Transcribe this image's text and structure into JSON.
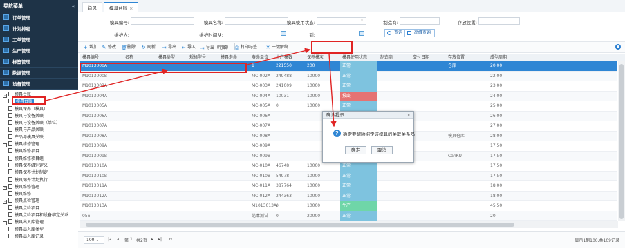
{
  "sidebar": {
    "title": "导航菜单",
    "collapse_icon": "«",
    "menus": [
      {
        "label": "订单管理"
      },
      {
        "label": "计划排程"
      },
      {
        "label": "工单管理"
      },
      {
        "label": "生产管理"
      },
      {
        "label": "标签管理"
      },
      {
        "label": "数据管理"
      },
      {
        "label": "设备管理"
      },
      {
        "label": "模具管理"
      }
    ],
    "tree": [
      {
        "label": "模具台账",
        "level": 1,
        "box": "-"
      },
      {
        "label": "模具台账",
        "level": 2,
        "selected": true
      },
      {
        "label": "模具保养（模具）",
        "level": 2
      },
      {
        "label": "模具与设备关联",
        "level": 2
      },
      {
        "label": "模具与设备关联（单位）",
        "level": 2
      },
      {
        "label": "模具与产品关联",
        "level": 2
      },
      {
        "label": "产品与模具关联",
        "level": 2
      },
      {
        "label": "模具维修管理",
        "level": 1,
        "box": "-"
      },
      {
        "label": "模具维修项目",
        "level": 2
      },
      {
        "label": "模具维修项目组",
        "level": 2
      },
      {
        "label": "模具保养级别定义",
        "level": 2
      },
      {
        "label": "模具保养计划制定",
        "level": 2
      },
      {
        "label": "模具保养计划执行",
        "level": 2
      },
      {
        "label": "模具维修管理",
        "level": 1,
        "box": "-"
      },
      {
        "label": "模具维修",
        "level": 2
      },
      {
        "label": "模具点检管理",
        "level": 1,
        "box": "-"
      },
      {
        "label": "模具点检项目",
        "level": 2
      },
      {
        "label": "模具点检项目和设备绑定关系",
        "level": 2
      },
      {
        "label": "模具出入库管理",
        "level": 1,
        "box": "-"
      },
      {
        "label": "模具出入库类型",
        "level": 2
      },
      {
        "label": "模具出入库记录",
        "level": 2
      }
    ]
  },
  "tabs": [
    {
      "label": "首页"
    },
    {
      "label": "模具台账",
      "close": "×"
    }
  ],
  "search": {
    "mold_no_label": "模具编号:",
    "mold_name_label": "模具名称:",
    "status_label": "模具使用状态:",
    "maker_label": "制造商:",
    "location_label": "存放位置:",
    "maintainer_label": "维护人:",
    "maint_time_label": "维护时间从:",
    "to_label": "到:",
    "query_btn": "查询",
    "adv_query_btn": "高级查询"
  },
  "toolbar": [
    {
      "label": "增加",
      "icon": "plus-icon",
      "glyph": "+"
    },
    {
      "label": "修改",
      "icon": "edit-icon",
      "glyph": "✎"
    },
    {
      "label": "删除",
      "icon": "trash-icon",
      "glyph": "🗑"
    },
    {
      "label": "刷新",
      "icon": "refresh-icon",
      "glyph": "↻"
    },
    {
      "label": "导出",
      "icon": "export-icon",
      "glyph": "⇥"
    },
    {
      "label": "导入",
      "icon": "import-icon",
      "glyph": "⇤"
    },
    {
      "label": "导出（明细）",
      "icon": "export-detail-icon",
      "glyph": "⇥"
    },
    {
      "label": "打印标签",
      "icon": "print-icon",
      "glyph": "⎙"
    },
    {
      "label": "一键解绑",
      "icon": "unbind-icon",
      "glyph": "✕"
    }
  ],
  "table": {
    "columns": [
      "模具编号",
      "名称",
      "模具类型",
      "规格型号",
      "模具寿命",
      "寿命单位",
      "生产模数",
      "保养模次",
      "模具使用状态",
      "制造商",
      "交付日期",
      "存放位置",
      "成型周期"
    ],
    "rows": [
      {
        "no": "M1013000A",
        "type": "1",
        "shots": "221550",
        "maint": "200",
        "status": "正常",
        "status_color": "#7ec3df",
        "location": "仓库",
        "cycle": "20.00",
        "selected": true
      },
      {
        "no": "M1013000B",
        "type": "MC-002A",
        "shots": "249488",
        "maint": "10000",
        "status": "正常",
        "status_color": "#7ec3df",
        "location": "",
        "cycle": "22.00"
      },
      {
        "no": "M1013002A",
        "type": "MC-003A",
        "shots": "241009",
        "maint": "10000",
        "status": "正常",
        "status_color": "#7ec3df",
        "location": "",
        "cycle": "23.00"
      },
      {
        "no": "M1013004A",
        "type": "MC-004A",
        "shots": "10031",
        "maint": "10000",
        "status": "报废",
        "status_color": "#e57373",
        "location": "",
        "cycle": "24.00"
      },
      {
        "no": "M1013005A",
        "type": "MC-005A",
        "shots": "0",
        "maint": "10000",
        "status": "正常",
        "status_color": "#7ec3df",
        "location": "",
        "cycle": "25.00"
      },
      {
        "no": "M1013006A",
        "type": "MC-006A",
        "shots": "",
        "maint": "",
        "status": "",
        "status_color": "#7ec3df",
        "location": "",
        "cycle": "26.00"
      },
      {
        "no": "M1013007A",
        "type": "MC-007A",
        "shots": "",
        "maint": "",
        "status": "",
        "status_color": "#7ec3df",
        "location": "",
        "cycle": "27.00"
      },
      {
        "no": "M1013008A",
        "type": "MC-008A",
        "shots": "",
        "maint": "",
        "status": "",
        "status_color": "#7ec3df",
        "location": "模具仓库",
        "cycle": "28.00"
      },
      {
        "no": "M1013009A",
        "type": "MC-009A",
        "shots": "",
        "maint": "",
        "status": "",
        "status_color": "#f1d54a",
        "location": "",
        "cycle": "17.50"
      },
      {
        "no": "M1013009B",
        "type": "MC-009B",
        "shots": "",
        "maint": "",
        "status": "",
        "status_color": "#7ec3df",
        "location": "CanKU",
        "cycle": "17.50"
      },
      {
        "no": "M1013010A",
        "type": "MC-010A",
        "shots": "46748",
        "maint": "10000",
        "status": "正常",
        "status_color": "#7ec3df",
        "location": "",
        "cycle": "17.50"
      },
      {
        "no": "M1013010B",
        "type": "MC-010B",
        "shots": "54978",
        "maint": "10000",
        "status": "正常",
        "status_color": "#7ec3df",
        "location": "",
        "cycle": "17.50"
      },
      {
        "no": "M1013011A",
        "type": "MC-011A",
        "shots": "387764",
        "maint": "10000",
        "status": "正常",
        "status_color": "#7ec3df",
        "location": "",
        "cycle": "18.00"
      },
      {
        "no": "M1013012A",
        "type": "MC-012A",
        "shots": "244363",
        "maint": "10000",
        "status": "正常",
        "status_color": "#7ec3df",
        "location": "",
        "cycle": "18.00"
      },
      {
        "no": "M1013013A",
        "type": "M1013013A",
        "shots": "0",
        "maint": "10000",
        "status": "生产",
        "status_color": "#6fd6a8",
        "location": "",
        "cycle": "45.50"
      },
      {
        "no": "056",
        "type": "范本测试",
        "shots": "0",
        "maint": "20000",
        "status": "正常",
        "status_color": "#7ec3df",
        "location": "",
        "cycle": "20"
      }
    ]
  },
  "pager": {
    "page_size": "100",
    "page_label": "第",
    "page_value": "1",
    "total_pages": "共2页",
    "summary": "显示1到100,共109记录"
  },
  "dialog": {
    "title": "确认提示",
    "close": "×",
    "message": "确定要解除绑定该模具的关联关系吗",
    "ok": "确定",
    "cancel": "取消"
  }
}
